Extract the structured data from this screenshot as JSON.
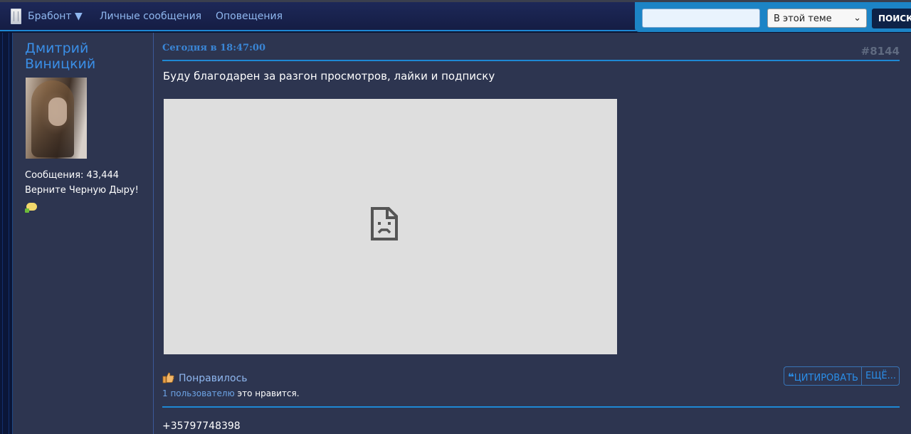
{
  "nav": {
    "account_label": "Брабонт ▼",
    "messages_label": "Личные сообщения",
    "notifications_label": "Оповещения",
    "search": {
      "value": "",
      "scope_selected": "В этой теме",
      "button_label": "ПОИСК"
    }
  },
  "post": {
    "author": {
      "name": "Дмитрий Виницкий",
      "messages_label": "Сообщения:",
      "messages_count": "43,444",
      "status_text": "Верните Черную Дыру!"
    },
    "timestamp": "Сегодня в 18:47:00",
    "number": "#8144",
    "message": "Буду благодарен за разгон просмотров, лайки и подписку",
    "like_label": "Понравилось",
    "likes_summary": {
      "users_link": "1 пользователю",
      "suffix": "это нравится."
    },
    "actions": {
      "quote_label": "ЦИТИРОВАТЬ",
      "quote_glyph": "❝",
      "more_label": "ЕЩЁ..."
    },
    "next_text": "+35797748398"
  },
  "icons": {
    "account": "phone-icon",
    "embed": "broken-document-icon",
    "like": "thumbs-up-icon",
    "status": "chat-bubble-icon"
  },
  "colors": {
    "accent": "#1e88d4",
    "link": "#3a8ee6",
    "post_bg": "#2d3550",
    "nav_bg": "#1d2858"
  }
}
